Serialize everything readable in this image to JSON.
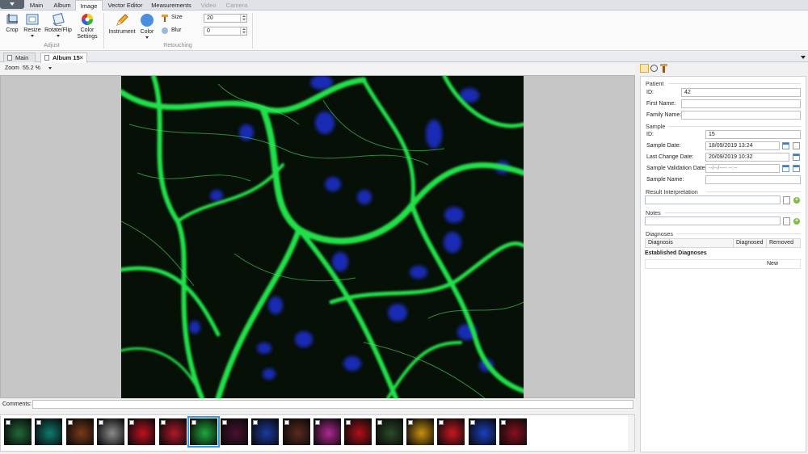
{
  "menu": {
    "tabs": [
      {
        "label": "Main"
      },
      {
        "label": "Album"
      },
      {
        "label": "Image"
      },
      {
        "label": "Vector Editor"
      },
      {
        "label": "Measurements"
      },
      {
        "label": "Video"
      },
      {
        "label": "Camera"
      }
    ],
    "active_tab": "Image"
  },
  "ribbon": {
    "adjust": {
      "group_label": "Adjust",
      "crop_label": "Crop",
      "resize_label": "Resize",
      "rotate_label": "Rotate/Flip",
      "color_settings_label_1": "Color",
      "color_settings_label_2": "Settings"
    },
    "retouching": {
      "group_label": "Retouching",
      "instrument_label": "Instrument",
      "color_label": "Color",
      "size_label": "Size",
      "size_value": "20",
      "blur_label": "Blur",
      "blur_value": "0"
    }
  },
  "doc_tabs": [
    {
      "label": "Main"
    },
    {
      "label": "Album 15"
    }
  ],
  "zoom": {
    "label": "Zoom",
    "value": "55.2 %"
  },
  "comments": {
    "label": "Comments:",
    "value": ""
  },
  "thumbnails": {
    "count": 17,
    "selected_index": 6,
    "colors": [
      "#1f6a3a",
      "#0f7a70",
      "#7a3a18",
      "#8a8a8a",
      "#c01020",
      "#b01828",
      "#1ea83a",
      "#4a1030",
      "#1a3aa0",
      "#5a2a20",
      "#b02890",
      "#b01018",
      "#2a4a28",
      "#c89010",
      "#c81820",
      "#1a40c0",
      "#8a1020"
    ]
  },
  "patient": {
    "section_title": "Patient",
    "id_label": "ID:",
    "id_value": "42",
    "first_name_label": "First Name:",
    "first_name_value": "",
    "family_name_label": "Family Name:",
    "family_name_value": ""
  },
  "sample": {
    "section_title": "Sample",
    "id_label": "ID:",
    "id_value": "15",
    "sample_date_label": "Sample Date:",
    "sample_date_value": "18/09/2019 13:24",
    "last_change_label": "Last Change Date:",
    "last_change_value": "20/09/2019 10:32",
    "validation_label": "Sample Validation Date:",
    "validation_value": "--/--/---- --:--",
    "name_label": "Sample Name:",
    "name_value": ""
  },
  "result_interpretation": {
    "section_title": "Result Interpretation",
    "value": ""
  },
  "notes": {
    "section_title": "Notes",
    "value": ""
  },
  "diagnoses": {
    "section_title": "Diagnoses",
    "columns": [
      "Diagnosis",
      "Diagnosed",
      "Removed"
    ],
    "established_label": "Established Diagnoses",
    "new_label": "New"
  }
}
